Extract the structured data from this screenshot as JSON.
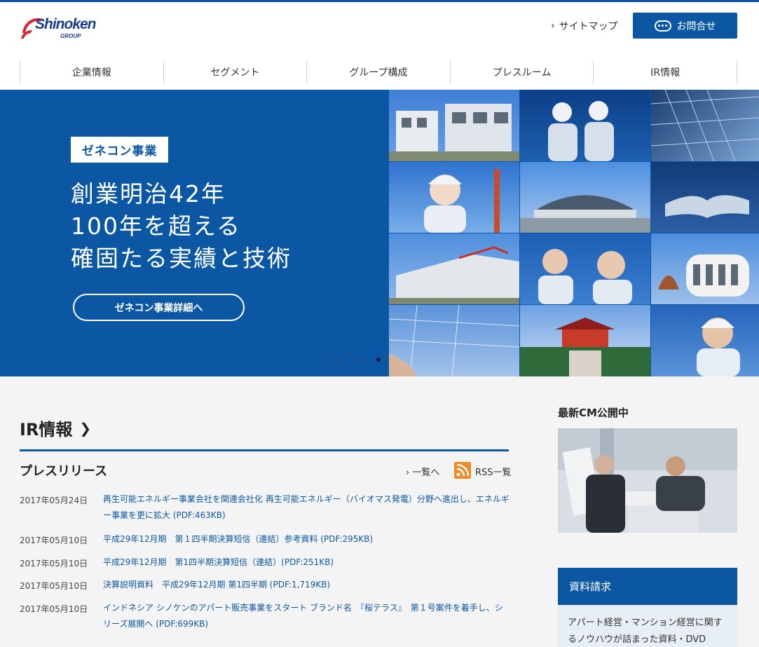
{
  "brand": {
    "logo_text": "Shinoken",
    "logo_subtext": "GROUP",
    "accent": "#0b57a4"
  },
  "header": {
    "sitemap_label": "サイトマップ",
    "contact_label": "お問合せ"
  },
  "nav": {
    "items": [
      {
        "label": "企業情報"
      },
      {
        "label": "セグメント"
      },
      {
        "label": "グループ構成"
      },
      {
        "label": "プレスルーム"
      },
      {
        "label": "IR情報"
      }
    ]
  },
  "hero": {
    "tag": "ゼネコン事業",
    "lines": [
      "創業明治42年",
      "100年を超える",
      "確固たる実績と技術"
    ],
    "button_label": "ゼネコン事業詳細へ",
    "slide_count": 3,
    "active_slide": 3
  },
  "ir": {
    "title": "IR情報",
    "press_title": "プレスリリース",
    "list_link": "一覧へ",
    "rss_label": "RSS一覧",
    "news": [
      {
        "date": "2017年05月24日",
        "title": "再生可能エネルギー事業会社を関連会社化 再生可能エネルギー（バイオマス発電）分野へ進出し、エネルギー事業を更に拡大 (PDF:463KB)"
      },
      {
        "date": "2017年05月10日",
        "title": "平成29年12月期　第１四半期決算短信（連結）参考資料 (PDF:295KB)"
      },
      {
        "date": "2017年05月10日",
        "title": "平成29年12月期　第1四半期決算短信（連結）(PDF:251KB)"
      },
      {
        "date": "2017年05月10日",
        "title": "決算説明資料　平成29年12月期 第1四半期 (PDF:1,719KB)"
      },
      {
        "date": "2017年05月10日",
        "title": "インドネシア シノケンのアパート販売事業をスタート ブランド名　『桜テラス』　第１号案件を着手し、シリーズ展開へ (PDF:699KB)"
      }
    ]
  },
  "sidebar": {
    "cm_title": "最新CM公開中",
    "request_title": "資料請求",
    "request_text": "アパート経営・マンション経営に関するノウハウが詰まった資料・DVD"
  }
}
